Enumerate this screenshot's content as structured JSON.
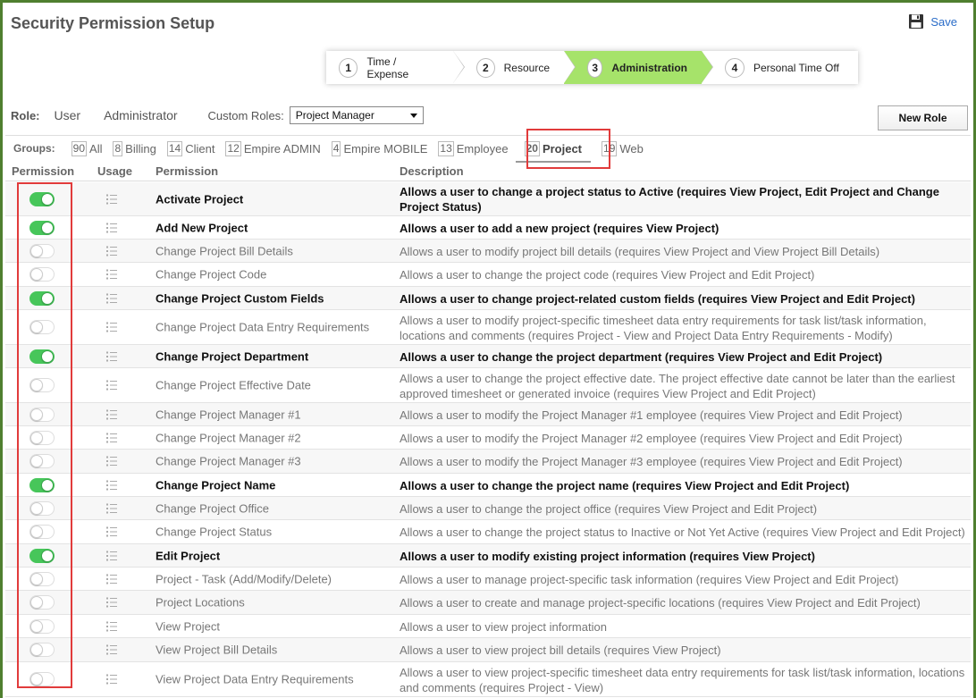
{
  "page": {
    "title": "Security Permission Setup",
    "save_label": "Save"
  },
  "wizard": {
    "steps": [
      {
        "num": "1",
        "label": "Time / Expense"
      },
      {
        "num": "2",
        "label": "Resource"
      },
      {
        "num": "3",
        "label": "Administration"
      },
      {
        "num": "4",
        "label": "Personal Time Off"
      }
    ],
    "active_step": "3",
    "active_color": "#a6e36a"
  },
  "role": {
    "label": "Role:",
    "options": [
      "User",
      "Administrator"
    ],
    "custom_label": "Custom Roles:",
    "custom_value": "Project Manager",
    "new_role_label": "New Role"
  },
  "groups": {
    "label": "Groups:",
    "items": [
      {
        "count": "90",
        "name": "All"
      },
      {
        "count": "8",
        "name": "Billing"
      },
      {
        "count": "14",
        "name": "Client"
      },
      {
        "count": "12",
        "name": "Empire ADMIN"
      },
      {
        "count": "4",
        "name": "Empire MOBILE"
      },
      {
        "count": "13",
        "name": "Employee"
      },
      {
        "count": "20",
        "name": "Project"
      },
      {
        "count": "19",
        "name": "Web"
      }
    ],
    "active": "Project"
  },
  "table": {
    "headers": {
      "permission": "Permission",
      "usage": "Usage",
      "name": "Permission",
      "description": "Description"
    },
    "rows": [
      {
        "on": true,
        "name": "Activate Project",
        "desc": "Allows a user to change a project status to Active (requires View Project, Edit Project and Change Project Status)"
      },
      {
        "on": true,
        "name": "Add New Project",
        "desc": "Allows a user to add a new project (requires View Project)"
      },
      {
        "on": false,
        "name": "Change Project Bill Details",
        "desc": "Allows a user to modify project bill details (requires View Project and View Project Bill Details)"
      },
      {
        "on": false,
        "name": "Change Project Code",
        "desc": "Allows a user to change the project code (requires View Project and Edit Project)"
      },
      {
        "on": true,
        "name": "Change Project Custom Fields",
        "desc": "Allows a user to change project-related custom fields (requires View Project and Edit Project)"
      },
      {
        "on": false,
        "name": "Change Project Data Entry Requirements",
        "desc": "Allows a user to modify project-specific timesheet data entry requirements for task list/task information, locations and comments (requires Project - View and Project Data Entry Requirements - Modify)"
      },
      {
        "on": true,
        "name": "Change Project Department",
        "desc": "Allows a user to change the project department (requires View Project and Edit Project)"
      },
      {
        "on": false,
        "name": "Change Project Effective Date",
        "desc": "Allows a user to change the project effective date. The project effective date cannot be later than the earliest approved timesheet or generated invoice (requires View Project and Edit Project)"
      },
      {
        "on": false,
        "name": "Change Project Manager #1",
        "desc": "Allows a user to modify the Project Manager #1 employee (requires View Project and Edit Project)"
      },
      {
        "on": false,
        "name": "Change Project Manager #2",
        "desc": "Allows a user to modify the Project Manager #2 employee (requires View Project and Edit Project)"
      },
      {
        "on": false,
        "name": "Change Project Manager #3",
        "desc": "Allows a user to modify the Project Manager #3 employee (requires View Project and Edit Project)"
      },
      {
        "on": true,
        "name": "Change Project Name",
        "desc": "Allows a user to change the project name (requires View Project and Edit Project)"
      },
      {
        "on": false,
        "name": "Change Project Office",
        "desc": "Allows a user to change the project office (requires View Project and Edit Project)"
      },
      {
        "on": false,
        "name": "Change Project Status",
        "desc": "Allows a user to change the project status to Inactive or Not Yet Active (requires View Project and Edit Project)"
      },
      {
        "on": true,
        "name": "Edit Project",
        "desc": "Allows a user to modify existing project information (requires View Project)"
      },
      {
        "on": false,
        "name": "Project - Task (Add/Modify/Delete)",
        "desc": "Allows a user to manage project-specific task information (requires View Project and Edit Project)"
      },
      {
        "on": false,
        "name": "Project Locations",
        "desc": "Allows a user to create and manage project-specific locations (requires View Project and Edit Project)"
      },
      {
        "on": false,
        "name": "View Project",
        "desc": "Allows a user to view project information"
      },
      {
        "on": false,
        "name": "View Project Bill Details",
        "desc": "Allows a user to view project bill details (requires View Project)"
      },
      {
        "on": false,
        "name": "View Project Data Entry Requirements",
        "desc": "Allows a user to view project-specific timesheet data entry requirements for task list/task information, locations and comments (requires Project - View)"
      }
    ]
  },
  "colors": {
    "toggle_on": "#47c65a",
    "highlight": "#e13b3b",
    "link": "#2a6cc8",
    "frame": "#4f7f2f"
  }
}
